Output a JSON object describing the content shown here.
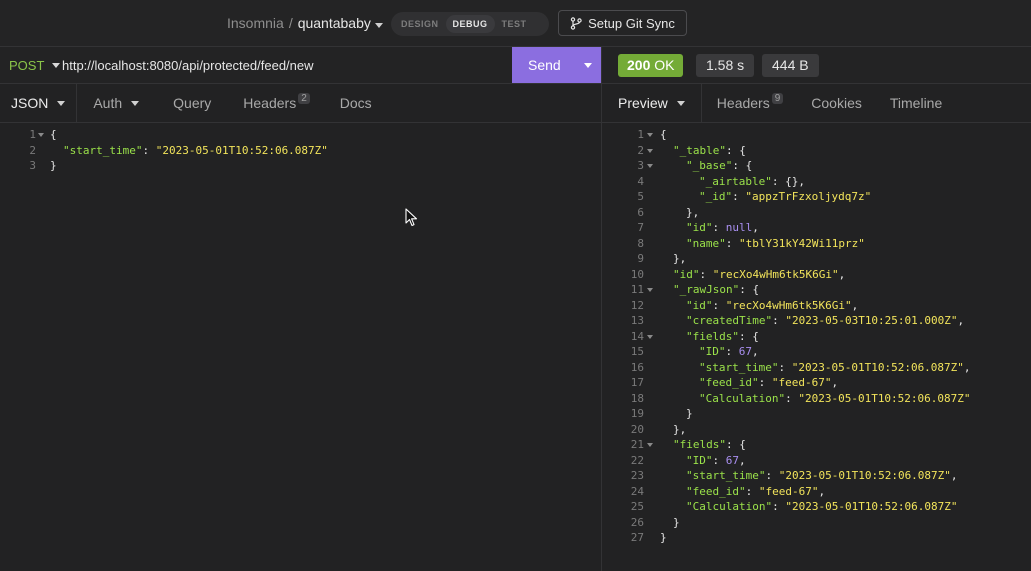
{
  "header": {
    "app": "Insomnia",
    "separator": "/",
    "project": "quantababy",
    "modes": [
      {
        "label": "DESIGN",
        "active": false
      },
      {
        "label": "DEBUG",
        "active": true
      },
      {
        "label": "TEST",
        "active": false
      }
    ],
    "git_label": "Setup Git Sync"
  },
  "request": {
    "method": "POST",
    "url": "http://localhost:8080/api/protected/feed/new",
    "send_label": "Send"
  },
  "response_meta": {
    "status_code": "200",
    "status_text": "OK",
    "time": "1.58 s",
    "size": "444 B"
  },
  "request_tabs": {
    "body": "JSON",
    "auth": "Auth",
    "query": "Query",
    "headers": "Headers",
    "headers_count": "2",
    "docs": "Docs"
  },
  "response_tabs": {
    "preview": "Preview",
    "headers": "Headers",
    "headers_count": "9",
    "cookies": "Cookies",
    "timeline": "Timeline"
  },
  "request_body": [
    {
      "num": "1",
      "fold": true,
      "indent": 0,
      "tokens": [
        [
          "p",
          "{"
        ]
      ]
    },
    {
      "num": "2",
      "fold": false,
      "indent": 1,
      "tokens": [
        [
          "k",
          "\"start_time\""
        ],
        [
          "p",
          ": "
        ],
        [
          "s",
          "\"2023-05-01T10:52:06.087Z\""
        ]
      ]
    },
    {
      "num": "3",
      "fold": false,
      "indent": 0,
      "tokens": [
        [
          "p",
          "}"
        ]
      ]
    }
  ],
  "response_body": [
    {
      "num": "1",
      "fold": true,
      "indent": 0,
      "tokens": [
        [
          "p",
          "{"
        ]
      ]
    },
    {
      "num": "2",
      "fold": true,
      "indent": 1,
      "tokens": [
        [
          "k",
          "\"_table\""
        ],
        [
          "p",
          ": {"
        ]
      ]
    },
    {
      "num": "3",
      "fold": true,
      "indent": 2,
      "tokens": [
        [
          "k",
          "\"_base\""
        ],
        [
          "p",
          ": {"
        ]
      ]
    },
    {
      "num": "4",
      "fold": false,
      "indent": 3,
      "tokens": [
        [
          "k",
          "\"_airtable\""
        ],
        [
          "p",
          ": {},"
        ]
      ]
    },
    {
      "num": "5",
      "fold": false,
      "indent": 3,
      "tokens": [
        [
          "k",
          "\"_id\""
        ],
        [
          "p",
          ": "
        ],
        [
          "s",
          "\"appzTrFzxoljydq7z\""
        ]
      ]
    },
    {
      "num": "6",
      "fold": false,
      "indent": 2,
      "tokens": [
        [
          "p",
          "},"
        ]
      ]
    },
    {
      "num": "7",
      "fold": false,
      "indent": 2,
      "tokens": [
        [
          "k",
          "\"id\""
        ],
        [
          "p",
          ": "
        ],
        [
          "n",
          "null"
        ],
        [
          "p",
          ","
        ]
      ]
    },
    {
      "num": "8",
      "fold": false,
      "indent": 2,
      "tokens": [
        [
          "k",
          "\"name\""
        ],
        [
          "p",
          ": "
        ],
        [
          "s",
          "\"tblY31kY42Wi11prz\""
        ]
      ]
    },
    {
      "num": "9",
      "fold": false,
      "indent": 1,
      "tokens": [
        [
          "p",
          "},"
        ]
      ]
    },
    {
      "num": "10",
      "fold": false,
      "indent": 1,
      "tokens": [
        [
          "k",
          "\"id\""
        ],
        [
          "p",
          ": "
        ],
        [
          "s",
          "\"recXo4wHm6tk5K6Gi\""
        ],
        [
          "p",
          ","
        ]
      ]
    },
    {
      "num": "11",
      "fold": true,
      "indent": 1,
      "tokens": [
        [
          "k",
          "\"_rawJson\""
        ],
        [
          "p",
          ": {"
        ]
      ]
    },
    {
      "num": "12",
      "fold": false,
      "indent": 2,
      "tokens": [
        [
          "k",
          "\"id\""
        ],
        [
          "p",
          ": "
        ],
        [
          "s",
          "\"recXo4wHm6tk5K6Gi\""
        ],
        [
          "p",
          ","
        ]
      ]
    },
    {
      "num": "13",
      "fold": false,
      "indent": 2,
      "tokens": [
        [
          "k",
          "\"createdTime\""
        ],
        [
          "p",
          ": "
        ],
        [
          "s",
          "\"2023-05-03T10:25:01.000Z\""
        ],
        [
          "p",
          ","
        ]
      ]
    },
    {
      "num": "14",
      "fold": true,
      "indent": 2,
      "tokens": [
        [
          "k",
          "\"fields\""
        ],
        [
          "p",
          ": {"
        ]
      ]
    },
    {
      "num": "15",
      "fold": false,
      "indent": 3,
      "tokens": [
        [
          "k",
          "\"ID\""
        ],
        [
          "p",
          ": "
        ],
        [
          "n",
          "67"
        ],
        [
          "p",
          ","
        ]
      ]
    },
    {
      "num": "16",
      "fold": false,
      "indent": 3,
      "tokens": [
        [
          "k",
          "\"start_time\""
        ],
        [
          "p",
          ": "
        ],
        [
          "s",
          "\"2023-05-01T10:52:06.087Z\""
        ],
        [
          "p",
          ","
        ]
      ]
    },
    {
      "num": "17",
      "fold": false,
      "indent": 3,
      "tokens": [
        [
          "k",
          "\"feed_id\""
        ],
        [
          "p",
          ": "
        ],
        [
          "s",
          "\"feed-67\""
        ],
        [
          "p",
          ","
        ]
      ]
    },
    {
      "num": "18",
      "fold": false,
      "indent": 3,
      "tokens": [
        [
          "k",
          "\"Calculation\""
        ],
        [
          "p",
          ": "
        ],
        [
          "s",
          "\"2023-05-01T10:52:06.087Z\""
        ]
      ]
    },
    {
      "num": "19",
      "fold": false,
      "indent": 2,
      "tokens": [
        [
          "p",
          "}"
        ]
      ]
    },
    {
      "num": "20",
      "fold": false,
      "indent": 1,
      "tokens": [
        [
          "p",
          "},"
        ]
      ]
    },
    {
      "num": "21",
      "fold": true,
      "indent": 1,
      "tokens": [
        [
          "k",
          "\"fields\""
        ],
        [
          "p",
          ": {"
        ]
      ]
    },
    {
      "num": "22",
      "fold": false,
      "indent": 2,
      "tokens": [
        [
          "k",
          "\"ID\""
        ],
        [
          "p",
          ": "
        ],
        [
          "n",
          "67"
        ],
        [
          "p",
          ","
        ]
      ]
    },
    {
      "num": "23",
      "fold": false,
      "indent": 2,
      "tokens": [
        [
          "k",
          "\"start_time\""
        ],
        [
          "p",
          ": "
        ],
        [
          "s",
          "\"2023-05-01T10:52:06.087Z\""
        ],
        [
          "p",
          ","
        ]
      ]
    },
    {
      "num": "24",
      "fold": false,
      "indent": 2,
      "tokens": [
        [
          "k",
          "\"feed_id\""
        ],
        [
          "p",
          ": "
        ],
        [
          "s",
          "\"feed-67\""
        ],
        [
          "p",
          ","
        ]
      ]
    },
    {
      "num": "25",
      "fold": false,
      "indent": 2,
      "tokens": [
        [
          "k",
          "\"Calculation\""
        ],
        [
          "p",
          ": "
        ],
        [
          "s",
          "\"2023-05-01T10:52:06.087Z\""
        ]
      ]
    },
    {
      "num": "26",
      "fold": false,
      "indent": 1,
      "tokens": [
        [
          "p",
          "}"
        ]
      ]
    },
    {
      "num": "27",
      "fold": false,
      "indent": 0,
      "tokens": [
        [
          "p",
          "}"
        ]
      ]
    }
  ],
  "colors": {
    "send": "#8b6ee0",
    "status_ok": "#74ab37",
    "method_post": "#8ac449",
    "json_key": "#9be24a",
    "json_string": "#f2e45b",
    "json_literal": "#a98ff0"
  },
  "icons": [
    "git-branch-icon",
    "chevron-down-icon",
    "fold-arrow-icon",
    "mouse-cursor-icon"
  ]
}
